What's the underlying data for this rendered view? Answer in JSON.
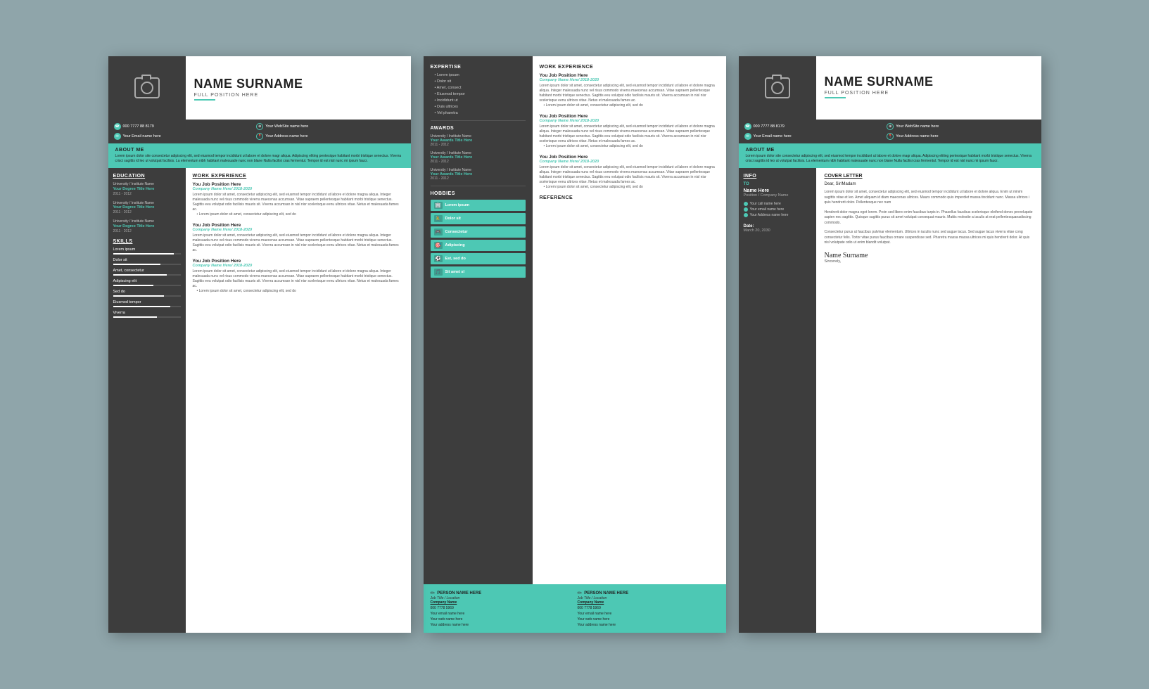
{
  "resume": {
    "name": "NAME SURNAME",
    "position": "FULL POSITION HERE",
    "contacts": [
      {
        "icon": "phone",
        "text": "000 7777 88 8179"
      },
      {
        "icon": "globe",
        "text": "Your WebSite name here"
      },
      {
        "icon": "email",
        "text": "Your Email name here"
      },
      {
        "icon": "map",
        "text": "Your Address name here"
      }
    ],
    "about_title": "ABOUT ME",
    "about_text": "Lorem ipsum dolor site consectetur adipiscing elit, sed eiusmod tempor incididunt ut labore et dolore magr aliqua. Adipiscing eliting pentesique habitant morbi tristique senectus. Viverra crisci sagittis id leo ut volutpat facilisis. La elementum nibh habitant malesuade nunc non blane Nulla facilisi cras fermentul. Tempor id est nisl nunc mi ipsum faucr.",
    "education_title": "EDUCATION",
    "education": [
      {
        "inst": "University / Institute Name",
        "degree": "Your Degree Title Here",
        "year": "2011 - 2012"
      },
      {
        "inst": "University / Institute Name",
        "degree": "Your Degree Title Here",
        "year": "2011 - 2012"
      },
      {
        "inst": "University / Institute Name",
        "degree": "Your Degree Title Here",
        "year": "2011 - 2012"
      }
    ],
    "skills_title": "SKILLS",
    "skills": [
      {
        "name": "Lorem ipsum",
        "pct": 90
      },
      {
        "name": "Dolor sit",
        "pct": 70
      },
      {
        "name": "Amet, consectetur",
        "pct": 80
      },
      {
        "name": "Adipiscing elit",
        "pct": 60
      },
      {
        "name": "Sed do",
        "pct": 75
      },
      {
        "name": "Eiusmod tempor",
        "pct": 85
      },
      {
        "name": "Viverra",
        "pct": 65
      }
    ],
    "work_title": "WORK EXPERIENCE",
    "work": [
      {
        "title": "You Job Position Here",
        "company": "Company Name Here/ 2018-2020",
        "desc": "Lorem ipsum dolor sit amet, consectetur adipiscing elit, sed eiusmod tempor incididunt ut labore et dolore magna aliqua. Integer malesuada nunc vel risus commodo viverra maecenas accumsan. Vitae sapraem pellentesque habitant morbi tristique senectus. Sagittis eeu volutpat odio facilisis mauris sit. Viverra accumsan in nisl nisr scelerisque eenu ultrices vitae. Netus et malesuada fames ac.",
        "bullet": "Lorem ipsum dolor sit amet, consectetur adipiscing elit, sed do"
      },
      {
        "title": "You Job Position Here",
        "company": "Company Name Here/ 2018-2020",
        "desc": "Lorem ipsum dolor sit amet, consectetur adipiscing elit, sed eiusmod tempor incididunt ut labore et dolore magna aliqua. Integer malesuada nunc vel risus commodo viverra maecenas accumsan. Vitae sapraem pellentesque habitant morbi tristique senectus. Sagittis eeu volutpat odio facilisis mauris sit. Viverra accumsan in nisl nisr scelerisque eenu ultrices vitae. Netus et malesuada fames ac.",
        "bullet": ""
      },
      {
        "title": "You Job Position Here",
        "company": "Company Name Here/ 2018-2020",
        "desc": "Lorem ipsum dolor sit amet, consectetur adipiscing elit, sed eiusmod tempor incididunt ut labore et dolore magna aliqua. Integer malesuada nunc vel risus commodo viverra maecenas accumsan. Vitae sapraem pellentesque habitant morbi tristique senectus. Sagittis eeu volutpat odio facilisis mauris sit. Viverra accumsan in nisl nisr scelerisque eenu ultrices vitae. Netus et malesuada fames ac.",
        "bullet": "Lorem ipsum dolor sit amet, consectetur adipiscing elit, sed do"
      }
    ]
  },
  "cv": {
    "expertise_title": "EXPERTISE",
    "expertise": [
      "Lorem ipsum",
      "Dolor sit",
      "Amet, consect",
      "Eiusmod tempor",
      "Incididunt ut",
      "Duis ultrices",
      "Vel pharetra"
    ],
    "awards_title": "AWARDS",
    "awards": [
      {
        "inst": "University / Institute Name",
        "title": "Your Awards Title Here",
        "year": "2011 - 2012"
      },
      {
        "inst": "University / Institute Name",
        "title": "Your Awards Title Here",
        "year": "2011 - 2012"
      },
      {
        "inst": "University / Institute Name",
        "title": "Your Awards Title Here",
        "year": "2011 - 2012"
      }
    ],
    "hobbies_title": "HOBBIES",
    "hobbies": [
      "Lorem ipsum",
      "Dolor sit",
      "Consectetur",
      "Adipiscing",
      "Est, sed do",
      "Sit amet sl"
    ],
    "work_title": "WORK EXPERIENCE",
    "work": [
      {
        "title": "You Job Position Here",
        "company": "Company Name Here/ 2018-2020",
        "desc": "Lorem ipsum dolor sit amet, consectetur adipiscing elit, sed eiusmod tempor incididunt ut labore et dolore magna aliqua. Integer malesuada nunc vel risus commodo viverra maecenas accumsan. Vitae sapraem pellentesque habitant morbi tristique senectus. Sagittis eeu volutpat odio facilisis mauris sit. Viverra accumsan in nisl nisr scelerisque eenu ultrices vitae. Netus et malesuada fames ac.",
        "bullet": "Lorem ipsum dolor sit amet, consectetur adipiscing elit, sed do"
      },
      {
        "title": "You Job Position Here",
        "company": "Company Name Here/ 2018-2020",
        "desc": "Lorem ipsum dolor sit amet, consectetur adipiscing elit, sed eiusmod tempor incididunt ut labore et dolore magna aliqua. Integer malesuada nunc vel risus commodo viverra maecenas accumsan. Vitae sapraem pellentesque habitant morbi tristique senectus. Sagittis eeu volutpat odio facilisis mauris sit. Viverra accumsan in nisl nisr scelerisque eenu ultrices vitae. Netus et malesuada fames ac.",
        "bullet": "Lorem ipsum dolor sit amet, consectetur adipiscing elit, sed do"
      },
      {
        "title": "You Job Position Here",
        "company": "Company Name Here/ 2018-2020",
        "desc": "Lorem ipsum dolor sit amet, consectetur adipiscing elit, sed eiusmod tempor incididunt ut labore et dolore magna aliqua. Integer malesuada nunc vel risus commodo viverra maecenas accumsan. Vitae sapraem pellentesque habitant morbi tristique senectus. Sagittis eeu volutpat odio facilisis mauris sit. Viverra accumsan in nisl nisr scelerisque eenu ultrices vitae. Netus et malesuada fames ac.",
        "bullet": "Lorem ipsum dolor sit amet, consectetur adipiscing elit, sed do"
      }
    ],
    "reference_title": "REFERENCE",
    "references": [
      {
        "name": "PERSON NAME HERE",
        "title": "Job Title / Location",
        "company": "Company Name",
        "phone": "000 7778 5969",
        "email": "Your email name here",
        "web": "Your web name here",
        "address": "Your address name here"
      },
      {
        "name": "PERSON NAME HERE",
        "title": "Job Title / Location",
        "company": "Company Name",
        "phone": "000 7778 5969",
        "email": "Your email name here",
        "web": "Your web name here",
        "address": "Your address name here"
      }
    ]
  },
  "cover": {
    "name": "NAME SURNAME",
    "position": "FULL POSITION HERE",
    "contacts": [
      {
        "icon": "phone",
        "text": "000 7777 88 8179"
      },
      {
        "icon": "globe",
        "text": "Your WebSite name here"
      },
      {
        "icon": "email",
        "text": "Your Email name here"
      },
      {
        "icon": "map",
        "text": "Your Address name here"
      }
    ],
    "about_title": "ABOUT ME",
    "about_text": "Lorem ipsum dolor site consectetur adipiscing elit, sed eiusmod tempor incididunt ut labore et dolore magr aliqua. Adipiscing eliting pentesique habitant morbi tristique senectus. Viverra crisci sagittis id leo ut volutpat facilisis. La elementum nibh habitant malesuade nunc non blane Nulla facilisi cras fermentul. Tempor id est nisl nunc mi ipsum faucr.",
    "info_title": "INFO",
    "to_label": "TO",
    "to_name": "Name Here",
    "to_position": "Position / Company Name",
    "to_contacts": [
      "Your call name here",
      "Your email name here",
      "Your Address name here"
    ],
    "date_label": "Date:",
    "date_value": "March 20, 2030",
    "letter_title": "COVER LETTER",
    "salutation": "Dear, Sir/Madam",
    "para1": "Lorem ipsum dolor sit amet, consectetur adipiscing elit, sed eiusmod tempor incididunt ut labore et dolore aliqua. Enim ut minim sagittis vitae et leo. Amet aliquam id diam maecenas ultrices. Maurs commodo quis imperdiet massa tincidunt nunc. Massa ultrices i quis hendrerit dolor. Pellentesque nec nam",
    "para2": "Hendrerit dolor magna eget lorem. Proin sed libero enim faucibus turpis in. Phasellus faucibus scelerisque eleifend donec prevelupate sapien nec sagittis. Quisque sagittis purus sit amet volutpat consequat mauris. Mattis molestie a iaculis at erat pellentesquaeadiscing commodo.",
    "para3": "Consectetur purus ut faucibus pulvinar elementum. Ultrices in iaculis nunc sed augue lacus. Sed augue lacus viverra vitae cong consectetur felis. Tortor vitae purus faucibus ornare suspendisse sed. Pharetra massa massa ultrices mi quis hendrerit dolor. At quis nisl volutpate odio ut enim blandit volutpat.",
    "sign_name": "Name Surname",
    "sign_close": "Sincerely,"
  },
  "colors": {
    "teal": "#4dc8b4",
    "dark": "#3d3d3d",
    "bg": "#8fa5aa"
  }
}
